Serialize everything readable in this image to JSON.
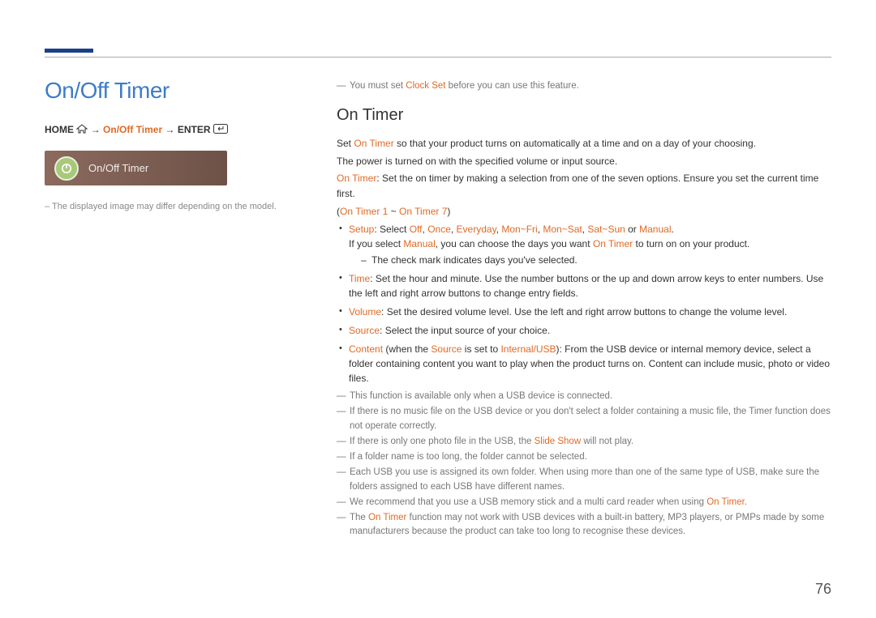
{
  "header": {
    "title": "On/Off Timer"
  },
  "nav": {
    "home": "HOME",
    "breadcrumb_item": "On/Off Timer",
    "enter": "ENTER",
    "arrow": "→"
  },
  "menu_shot": {
    "label": "On/Off Timer",
    "icon": "timer-power-icon"
  },
  "disclaimer": "The displayed image may differ depending on the model.",
  "right": {
    "preface_note_pre": "You must set ",
    "preface_note_hl": "Clock Set",
    "preface_note_post": " before you can use this feature.",
    "section_title": "On Timer",
    "p1_pre": "Set ",
    "p1_hl": "On Timer",
    "p1_post": " so that your product turns on automatically at a time and on a day of your choosing.",
    "p2": "The power is turned on with the specified volume or input source.",
    "p3_hl": "On Timer",
    "p3_post": ": Set the on timer by making a selection from one of the seven options. Ensure you set the current time first.",
    "range": "(",
    "range_hl1": "On Timer 1",
    "range_tilde": " ~ ",
    "range_hl2": "On Timer 7",
    "range_close": ")",
    "bullets": {
      "setup": {
        "label": "Setup",
        "sep": ": Select ",
        "off": "Off",
        "c": ", ",
        "once": "Once",
        "everyday": "Everyday",
        "monfri": "Mon~Fri",
        "monsat": "Mon~Sat",
        "satsun": "Sat~Sun",
        "or": " or ",
        "manual": "Manual",
        "dot": ".",
        "line2_pre": "If you select ",
        "line2_hl1": "Manual",
        "line2_mid": ", you can choose the days you want ",
        "line2_hl2": "On Timer",
        "line2_post": " to turn on on your product.",
        "sub1": "The check mark indicates days you've selected."
      },
      "time": {
        "label": "Time",
        "text": ": Set the hour and minute. Use the number buttons or the up and down arrow keys to enter numbers. Use the left and right arrow buttons to change entry fields."
      },
      "volume": {
        "label": "Volume",
        "text": ": Set the desired volume level. Use the left and right arrow buttons to change the volume level."
      },
      "source": {
        "label": "Source",
        "text": ": Select the input source of your choice."
      },
      "content": {
        "label": "Content",
        "pre": " (when the ",
        "hl1": "Source",
        "mid": " is set to ",
        "hl2": "Internal/USB",
        "post": "): From the USB device or internal memory device, select a folder containing content you want to play when the product turns on. Content can include music, photo or video files."
      }
    },
    "notes": {
      "n1": "This function is available only when a USB device is connected.",
      "n2": "If there is no music file on the USB device or you don't select a folder containing a music file, the Timer function does not operate correctly.",
      "n3_pre": "If there is only one photo file in the USB, the ",
      "n3_hl": "Slide Show",
      "n3_post": " will not play.",
      "n4": "If a folder name is too long, the folder cannot be selected.",
      "n5": "Each USB you use is assigned its own folder. When using more than one of the same type of USB, make sure the folders assigned to each USB have different names.",
      "n6_pre": "We recommend that you use a USB memory stick and a multi card reader when using ",
      "n6_hl": "On Timer",
      "n6_post": ".",
      "n7_pre": "The ",
      "n7_hl": "On Timer",
      "n7_post": " function may not work with USB devices with a built-in battery, MP3 players, or PMPs made by some manufacturers because the product can take too long to recognise these devices."
    }
  },
  "page_number": "76"
}
